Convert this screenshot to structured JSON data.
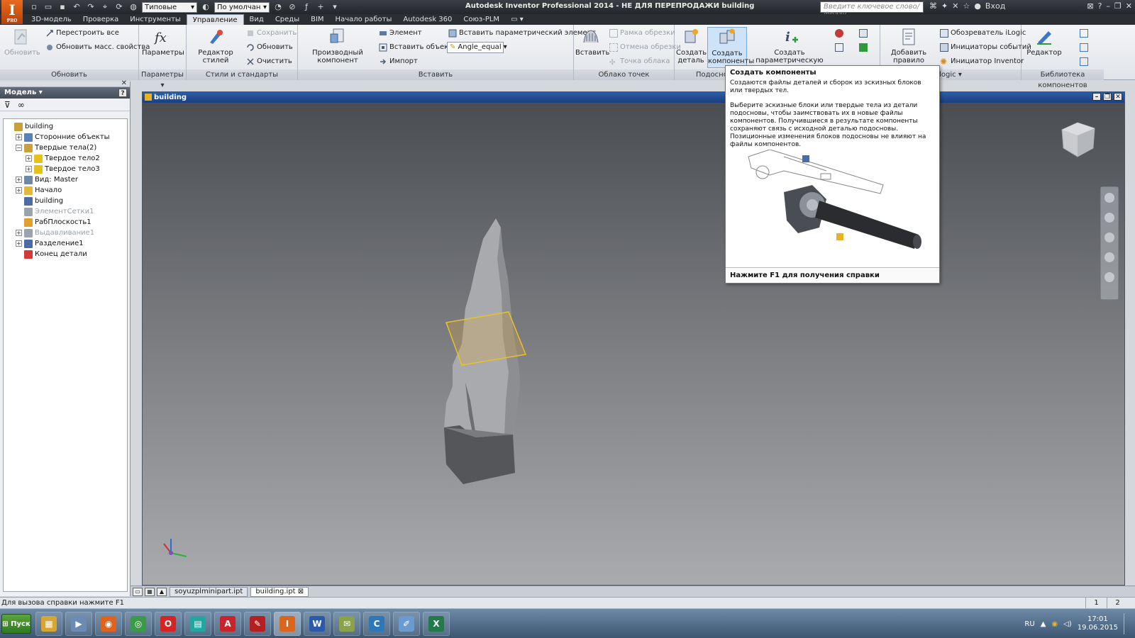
{
  "app": {
    "logo": "I",
    "logo_sub": "PRO",
    "title": "Autodesk Inventor Professional 2014 - НЕ ДЛЯ ПЕРЕПРОДАЖИ   building",
    "search_placeholder": "Введите ключевое слово/фразу",
    "login": "Вход",
    "qat_combo1": "Типовые",
    "qat_combo2": "По умолчан"
  },
  "menu": {
    "tabs": [
      "3D-модель",
      "Проверка",
      "Инструменты",
      "Управление",
      "Вид",
      "Среды",
      "BIM",
      "Начало работы",
      "Autodesk 360",
      "Союз-PLM"
    ],
    "active": 3
  },
  "ribbon": {
    "update": {
      "label": "Обновить",
      "btn": "Обновить",
      "rebuild": "Перестроить все",
      "mass": "Обновить масс. свойства"
    },
    "params": {
      "label": "Параметры",
      "btn": "Параметры"
    },
    "styles": {
      "label": "Стили и стандарты",
      "editor": "Редактор стилей",
      "save": "Сохранить",
      "update": "Обновить",
      "clean": "Очистить"
    },
    "insert": {
      "label": "Вставить",
      "derived": "Производный компонент",
      "element": "Элемент",
      "insert_obj": "Вставить объект",
      "import": "Импорт",
      "param_elem": "Вставить параметрический элемент",
      "combo": "Angle_equal"
    },
    "cloud": {
      "label": "Облако точек",
      "insert": "Вставить",
      "crop": "Рамка обрезки",
      "uncrop": "Отмена обрезки",
      "point": "Точка облака"
    },
    "layout": {
      "label": "Подосно",
      "make_part": "Создать деталь",
      "make_components": "Создать компоненты",
      "param_part": "Создать параметрическую деталь"
    },
    "ilogic": {
      "label": "logic",
      "add_rule": "Добавить правило",
      "browser": "Обозреватель iLogic",
      "triggers": "Инициаторы событий",
      "initiator": "Инициатор Inventor"
    },
    "library": {
      "label": "Библиотека компонентов",
      "editor": "Редактор"
    }
  },
  "browser": {
    "title": "Модель ▾",
    "help": "?",
    "tree": [
      {
        "label": "building",
        "level": 0,
        "pm": "",
        "color": "#c9a13a",
        "dim": false
      },
      {
        "label": "Сторонние объекты",
        "level": 1,
        "pm": "+",
        "color": "#5b7fb8",
        "dim": false
      },
      {
        "label": "Твердые тела(2)",
        "level": 1,
        "pm": "−",
        "color": "#c9a13a",
        "dim": false
      },
      {
        "label": "Твердое тело2",
        "level": 2,
        "pm": "+",
        "color": "#e4c21b",
        "dim": false
      },
      {
        "label": "Твердое тело3",
        "level": 2,
        "pm": "+",
        "color": "#e4c21b",
        "dim": false
      },
      {
        "label": "Вид: Master",
        "level": 1,
        "pm": "+",
        "color": "#6f8aa8",
        "dim": false
      },
      {
        "label": "Начало",
        "level": 1,
        "pm": "+",
        "color": "#e2b93b",
        "dim": false
      },
      {
        "label": "building",
        "level": 1,
        "pm": "",
        "color": "#4d6aa3",
        "dim": false
      },
      {
        "label": "ЭлементСетки1",
        "level": 1,
        "pm": "",
        "color": "#9aa3ae",
        "dim": true
      },
      {
        "label": "РабПлоскость1",
        "level": 1,
        "pm": "",
        "color": "#e0a030",
        "dim": false
      },
      {
        "label": "Выдавливание1",
        "level": 1,
        "pm": "+",
        "color": "#9aa3ae",
        "dim": true
      },
      {
        "label": "Разделение1",
        "level": 1,
        "pm": "+",
        "color": "#4d6aa3",
        "dim": false
      },
      {
        "label": "Конец детали",
        "level": 1,
        "pm": "",
        "color": "#d23a3a",
        "dim": false
      }
    ]
  },
  "document": {
    "title": "building"
  },
  "tooltip": {
    "title": "Создать компоненты",
    "p1": "Создаются файлы деталей и сборок из эскизных блоков или твердых тел.",
    "p2": "Выберите эскизные блоки или твердые тела из детали подосновы, чтобы заимствовать их в новые файлы компонентов. Получившиеся в результате компоненты сохраняют связь с исходной деталью подосновы. Позиционные изменения блоков подосновы не влияют на файлы компонентов.",
    "footer": "Нажмите F1 для получения справки"
  },
  "doctabs": [
    "soyuzplminipart.ipt",
    "building.ipt"
  ],
  "status": {
    "text": "Для вызова справки нажмите F1",
    "num1": "1",
    "num2": "2"
  },
  "taskbar": {
    "start": "Пуск",
    "lang": "RU",
    "time": "17:01",
    "date": "19.06.2015",
    "apps": [
      {
        "name": "explorer",
        "color": "#d9a532",
        "glyph": "▦"
      },
      {
        "name": "media",
        "color": "#6b8bb5",
        "glyph": "▶"
      },
      {
        "name": "firefox",
        "color": "#e0621f",
        "glyph": "◉"
      },
      {
        "name": "chrome",
        "color": "#3a9a4a",
        "glyph": "◎"
      },
      {
        "name": "opera",
        "color": "#d42424",
        "glyph": "O"
      },
      {
        "name": "calc",
        "color": "#22a6a0",
        "glyph": "▤"
      },
      {
        "name": "autocad",
        "color": "#c8242b",
        "glyph": "A"
      },
      {
        "name": "acrobat",
        "color": "#b51f1f",
        "glyph": "✎"
      },
      {
        "name": "inventor",
        "color": "#d9661c",
        "glyph": "I"
      },
      {
        "name": "word",
        "color": "#2b5ba8",
        "glyph": "W"
      },
      {
        "name": "notes",
        "color": "#8aa34a",
        "glyph": "✉"
      },
      {
        "name": "ccleaner",
        "color": "#2f78b8",
        "glyph": "C"
      },
      {
        "name": "paint",
        "color": "#6a9bd0",
        "glyph": "✐"
      },
      {
        "name": "excel",
        "color": "#22794a",
        "glyph": "X"
      }
    ]
  }
}
